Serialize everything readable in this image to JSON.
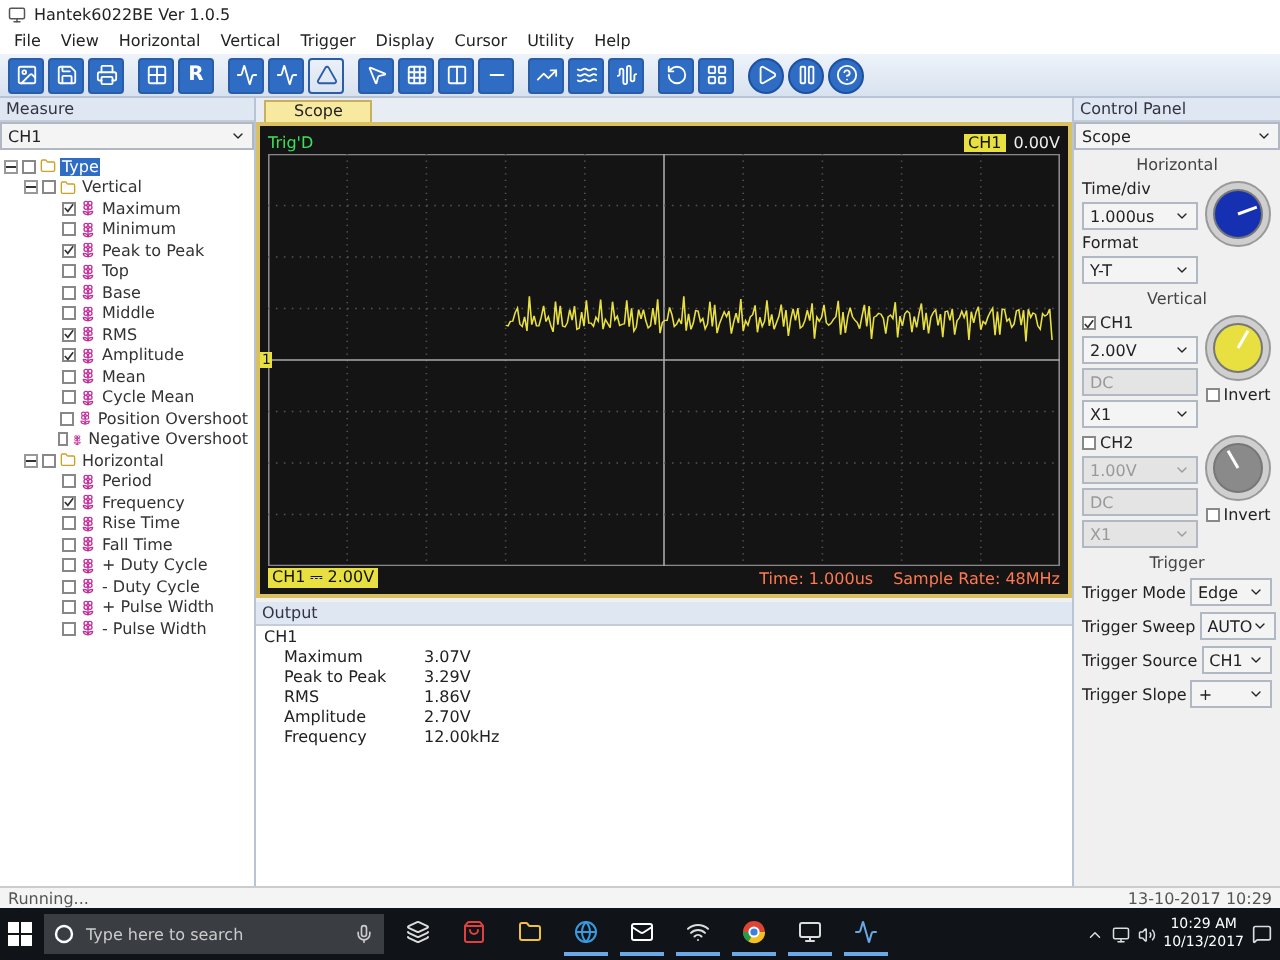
{
  "window": {
    "title": "Hantek6022BE Ver 1.0.5"
  },
  "menu": [
    "File",
    "View",
    "Horizontal",
    "Vertical",
    "Trigger",
    "Display",
    "Cursor",
    "Utility",
    "Help"
  ],
  "toolbar": {
    "letter_button": "R"
  },
  "measure_panel": {
    "title": "Measure",
    "channel": "CH1",
    "tree": [
      {
        "label": "Type",
        "checked": false,
        "expanded": true,
        "selected": true,
        "children": [
          {
            "label": "Vertical",
            "checked": false,
            "expanded": true,
            "selected": false,
            "children": [
              {
                "label": "Maximum",
                "checked": true,
                "selected": false
              },
              {
                "label": "Minimum",
                "checked": false,
                "selected": false
              },
              {
                "label": "Peak to Peak",
                "checked": true,
                "selected": false
              },
              {
                "label": "Top",
                "checked": false,
                "selected": false
              },
              {
                "label": "Base",
                "checked": false,
                "selected": false
              },
              {
                "label": "Middle",
                "checked": false,
                "selected": false
              },
              {
                "label": "RMS",
                "checked": true,
                "selected": false
              },
              {
                "label": "Amplitude",
                "checked": true,
                "selected": false
              },
              {
                "label": "Mean",
                "checked": false,
                "selected": false
              },
              {
                "label": "Cycle Mean",
                "checked": false,
                "selected": false
              },
              {
                "label": "Position Overshoot",
                "checked": false,
                "selected": false
              },
              {
                "label": "Negative Overshoot",
                "checked": false,
                "selected": false
              }
            ]
          },
          {
            "label": "Horizontal",
            "checked": false,
            "expanded": true,
            "selected": false,
            "children": [
              {
                "label": "Period",
                "checked": false,
                "selected": false
              },
              {
                "label": "Frequency",
                "checked": true,
                "selected": false
              },
              {
                "label": "Rise Time",
                "checked": false,
                "selected": false
              },
              {
                "label": "Fall Time",
                "checked": false,
                "selected": false
              },
              {
                "label": "+ Duty Cycle",
                "checked": false,
                "selected": false
              },
              {
                "label": "- Duty Cycle",
                "checked": false,
                "selected": false
              },
              {
                "label": "+ Pulse Width",
                "checked": false,
                "selected": false
              },
              {
                "label": "- Pulse Width",
                "checked": false,
                "selected": false
              }
            ]
          }
        ]
      }
    ]
  },
  "scope": {
    "tab": "Scope",
    "trigger_status": "Trig'D",
    "channel_tag": "CH1",
    "trigger_level": "0.00V",
    "channel_marker": "1",
    "channel_scale": "CH1 ⎓ 2.00V",
    "time": "Time: 1.000us",
    "sample_rate": "Sample Rate: 48MHz"
  },
  "output": {
    "title": "Output",
    "channel": "CH1",
    "rows": [
      {
        "name": "Maximum",
        "value": "3.07V"
      },
      {
        "name": "Peak to Peak",
        "value": "3.29V"
      },
      {
        "name": "RMS",
        "value": "1.86V"
      },
      {
        "name": "Amplitude",
        "value": "2.70V"
      },
      {
        "name": "Frequency",
        "value": "12.00kHz"
      }
    ]
  },
  "control_panel": {
    "title": "Control Panel",
    "view": "Scope",
    "horizontal": {
      "title": "Horizontal",
      "fields": [
        {
          "label": "Time/div",
          "value": "1.000us"
        },
        {
          "label": "Format",
          "value": "Y-T"
        }
      ]
    },
    "vertical": {
      "title": "Vertical",
      "channels": [
        {
          "label": "CH1",
          "checked": true,
          "scale": "2.00V",
          "coupling": "DC",
          "probe": "X1",
          "invert_label": "Invert",
          "invert": false,
          "color": "#e8e040"
        },
        {
          "label": "CH2",
          "checked": false,
          "scale": "1.00V",
          "coupling": "DC",
          "probe": "X1",
          "invert_label": "Invert",
          "invert": false,
          "color": "#8a8a8a"
        }
      ]
    },
    "trigger": {
      "title": "Trigger",
      "fields": [
        {
          "label": "Trigger Mode",
          "value": "Edge"
        },
        {
          "label": "Trigger Sweep",
          "value": "AUTO"
        },
        {
          "label": "Trigger Source",
          "value": "CH1"
        },
        {
          "label": "Trigger Slope",
          "value": "+"
        }
      ]
    }
  },
  "status_bar": {
    "text": "Running...",
    "timestamp": "13-10-2017 10:29"
  },
  "taskbar": {
    "search_placeholder": "Type here to search",
    "time": "10:29 AM",
    "date": "10/13/2017"
  }
}
